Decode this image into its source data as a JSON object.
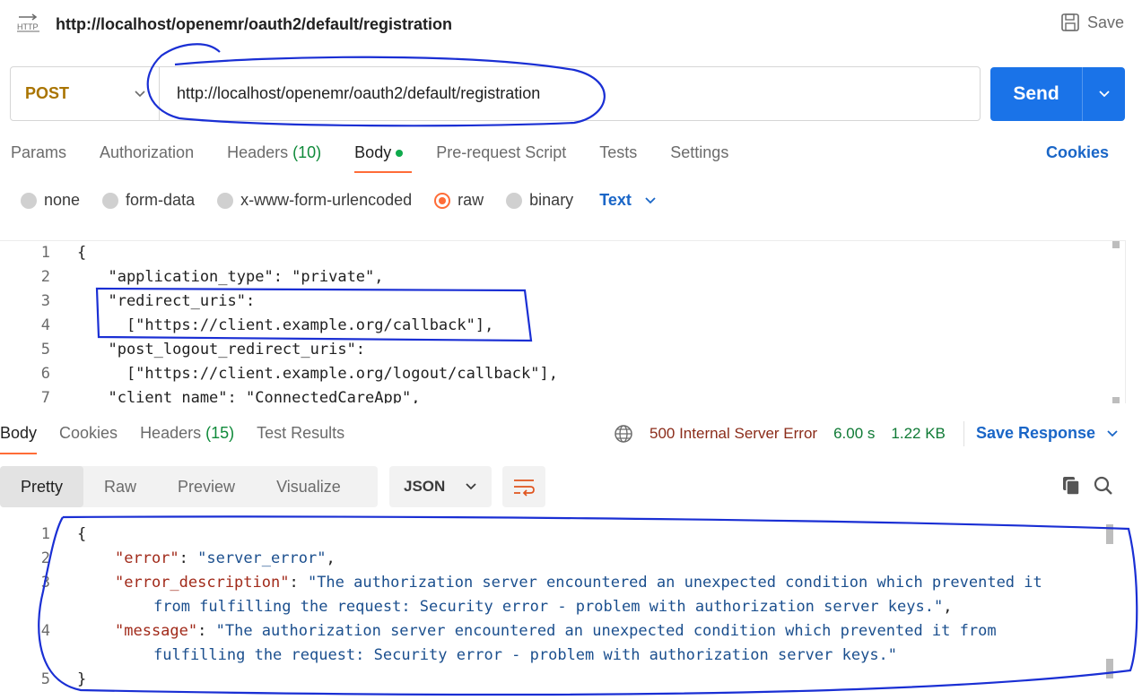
{
  "header": {
    "icon": "http-icon",
    "icon_text": "HTTP",
    "title": "http://localhost/openemr/oauth2/default/registration",
    "save_label": "Save"
  },
  "request": {
    "method": "POST",
    "url": "http://localhost/openemr/oauth2/default/registration",
    "send_label": "Send"
  },
  "request_tabs": [
    {
      "label": "Params"
    },
    {
      "label": "Authorization"
    },
    {
      "label": "Headers",
      "count": "(10)"
    },
    {
      "label": "Body"
    },
    {
      "label": "Pre-request Script"
    },
    {
      "label": "Tests"
    },
    {
      "label": "Settings"
    }
  ],
  "cookies_label": "Cookies",
  "body_types": [
    "none",
    "form-data",
    "x-www-form-urlencoded",
    "raw",
    "binary"
  ],
  "body_type_selected": "raw",
  "text_format": "Text",
  "request_body_lines": [
    {
      "n": "1",
      "text": "{"
    },
    {
      "n": "2",
      "text": "  \"application_type\": \"private\","
    },
    {
      "n": "3",
      "text": "  \"redirect_uris\":"
    },
    {
      "n": "4",
      "text": "    [\"https://client.example.org/callback\"],"
    },
    {
      "n": "5",
      "text": "  \"post_logout_redirect_uris\":"
    },
    {
      "n": "6",
      "text": "    [\"https://client.example.org/logout/callback\"],"
    },
    {
      "n": "7",
      "text": "  \"client_name\": \"ConnectedCareApp\","
    }
  ],
  "response_tabs": [
    {
      "label": "Body"
    },
    {
      "label": "Cookies"
    },
    {
      "label": "Headers",
      "count": "(15)"
    },
    {
      "label": "Test Results"
    }
  ],
  "response_status": {
    "status": "500 Internal Server Error",
    "time": "6.00 s",
    "size": "1.22 KB",
    "save_response": "Save Response"
  },
  "view_tabs": [
    "Pretty",
    "Raw",
    "Preview",
    "Visualize"
  ],
  "response_format": "JSON",
  "response_lines": [
    {
      "n": "1",
      "text": "{"
    },
    {
      "n": "2",
      "key": "\"error\"",
      "sep": ": ",
      "val": "\"server_error\"",
      "tail": ","
    },
    {
      "n": "3",
      "key": "\"error_description\"",
      "sep": ": ",
      "val": "\"The authorization server encountered an unexpected condition which prevented it",
      "tail": ""
    },
    {
      "n": "",
      "key": "",
      "sep": "",
      "val": "from fulfilling the request: Security error - problem with authorization server keys.\"",
      "tail": ","
    },
    {
      "n": "4",
      "key": "\"message\"",
      "sep": ": ",
      "val": "\"The authorization server encountered an unexpected condition which prevented it from",
      "tail": ""
    },
    {
      "n": "",
      "key": "",
      "sep": "",
      "val": "fulfilling the request: Security error - problem with authorization server keys.\"",
      "tail": ""
    },
    {
      "n": "5",
      "text": "}"
    }
  ],
  "colors": {
    "accent": "#1a73e8",
    "method": "#a97400",
    "tab_indicator": "#ff6c37",
    "status_error": "#8b2c1a",
    "status_ok": "#0f7a35",
    "annotation": "#1a2fd4"
  }
}
